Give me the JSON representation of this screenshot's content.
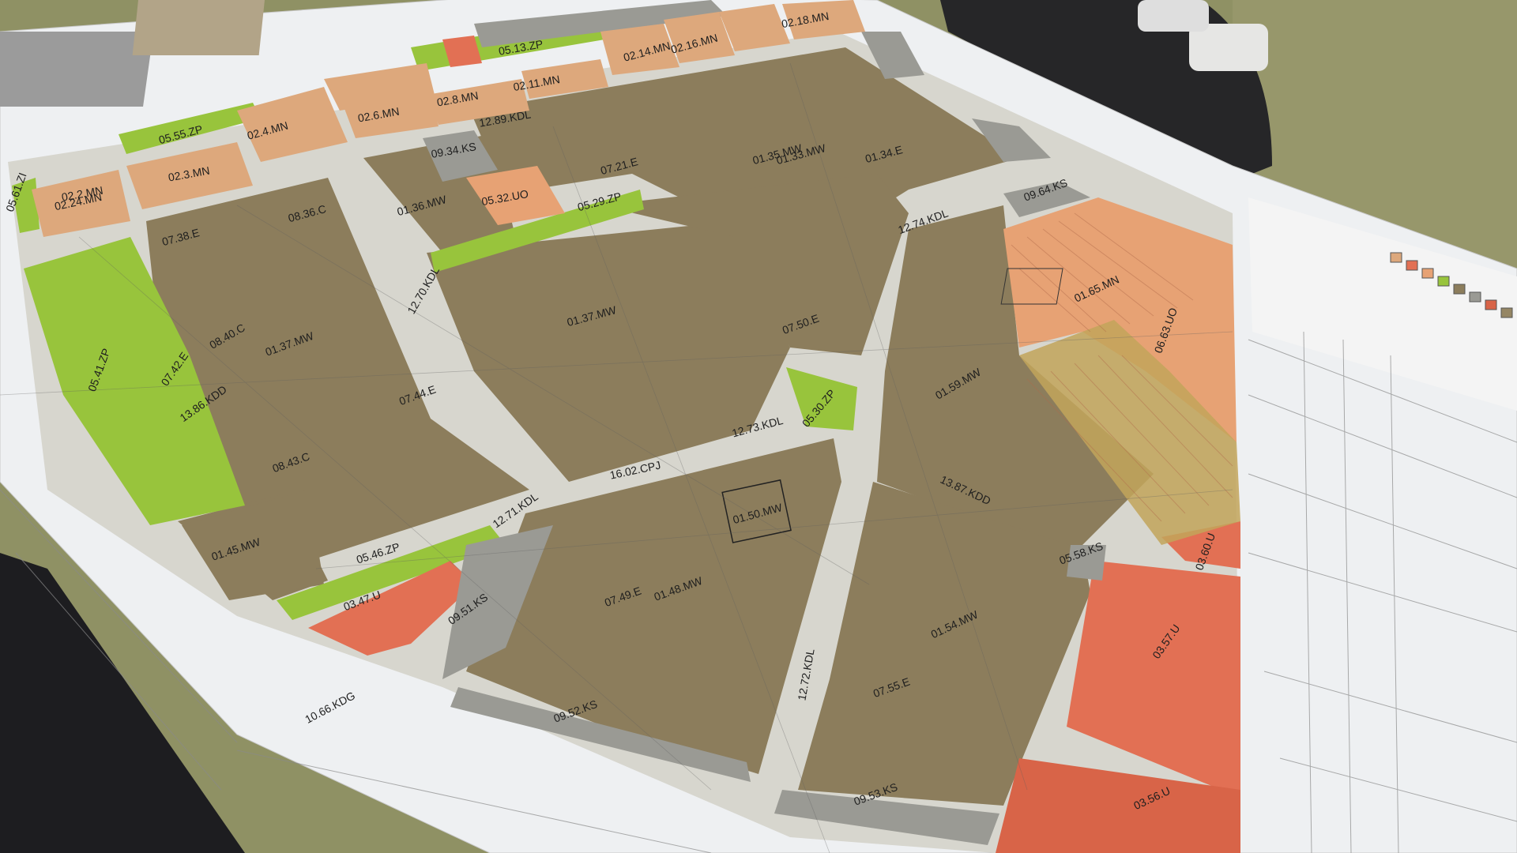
{
  "map": {
    "zone_colors": {
      "mw": "#8c7d5c",
      "mw_light": "#958664",
      "zp": "#98c43c",
      "u": "#e27054",
      "u_dark": "#d86448",
      "road": "#d7d6ce",
      "ks": "#9a9a94",
      "mn": "#dda87c",
      "uo": "#e7a274",
      "sheet": "#eef0f2"
    },
    "labels": [
      {
        "id": "l1",
        "text": "01.45.MW"
      },
      {
        "id": "l2",
        "text": "05.41.ZP"
      },
      {
        "id": "l3",
        "text": "07.42.E"
      },
      {
        "id": "l4",
        "text": "13.86.KDD"
      },
      {
        "id": "l5",
        "text": "08.43.C"
      },
      {
        "id": "l6",
        "text": "01.37.MW"
      },
      {
        "id": "l7",
        "text": "08.40.C"
      },
      {
        "id": "l8",
        "text": "07.44.E"
      },
      {
        "id": "l9",
        "text": "05.46.ZP"
      },
      {
        "id": "l10",
        "text": "03.47.U"
      },
      {
        "id": "l11",
        "text": "09.51.KS"
      },
      {
        "id": "l12",
        "text": "10.66.KDG"
      },
      {
        "id": "l13",
        "text": "12.71.KDL"
      },
      {
        "id": "l14",
        "text": "16.02.CPJ"
      },
      {
        "id": "l15",
        "text": "12.70.KDL"
      },
      {
        "id": "l16",
        "text": "01.50.MW"
      },
      {
        "id": "l17",
        "text": "07.49.E"
      },
      {
        "id": "l18",
        "text": "01.48.MW"
      },
      {
        "id": "l19",
        "text": "09.52.KS"
      },
      {
        "id": "l20",
        "text": "12.72.KDL"
      },
      {
        "id": "l21",
        "text": "07.55.E"
      },
      {
        "id": "l22",
        "text": "01.54.MW"
      },
      {
        "id": "l23",
        "text": "09.53.KS"
      },
      {
        "id": "l24",
        "text": "03.56.U"
      },
      {
        "id": "l25",
        "text": "03.57.U"
      },
      {
        "id": "l26",
        "text": "05.30.ZP"
      },
      {
        "id": "l27",
        "text": "12.73.KDL"
      },
      {
        "id": "l28",
        "text": "13.87.KDD"
      },
      {
        "id": "l29",
        "text": "05.58.KS"
      },
      {
        "id": "l30",
        "text": "03.60.U"
      },
      {
        "id": "l31",
        "text": "01.59.MW"
      },
      {
        "id": "l32",
        "text": "01.37.MW"
      },
      {
        "id": "l33",
        "text": "05.32.UO"
      },
      {
        "id": "l34",
        "text": "05.29.ZP"
      },
      {
        "id": "l35",
        "text": "01.36.MW"
      },
      {
        "id": "l36",
        "text": "01.35.MW"
      },
      {
        "id": "l37",
        "text": "02.24.MN"
      },
      {
        "id": "l38",
        "text": "02.3.MN"
      },
      {
        "id": "l39",
        "text": "02.4.MN"
      },
      {
        "id": "l40",
        "text": "02.6.MN"
      },
      {
        "id": "l41",
        "text": "02.8.MN"
      },
      {
        "id": "l42",
        "text": "02.11.MN"
      },
      {
        "id": "l43",
        "text": "02.14.MN"
      },
      {
        "id": "l44",
        "text": "02.16.MN"
      },
      {
        "id": "l45",
        "text": "02.18.MN"
      },
      {
        "id": "l46",
        "text": "05.55.ZP"
      },
      {
        "id": "l47",
        "text": "05.13.ZP"
      },
      {
        "id": "l48",
        "text": "12.89.KDL"
      },
      {
        "id": "l49",
        "text": "09.34.KS"
      },
      {
        "id": "l50",
        "text": "07.38.E"
      },
      {
        "id": "l51",
        "text": "08.36.C"
      },
      {
        "id": "l52",
        "text": "01.33.MW"
      },
      {
        "id": "l53",
        "text": "01.34.E"
      },
      {
        "id": "l54",
        "text": "07.50.E"
      },
      {
        "id": "l55",
        "text": "12.74.KDL"
      },
      {
        "id": "l56",
        "text": "09.64.KS"
      },
      {
        "id": "l57",
        "text": "06.63.UO"
      },
      {
        "id": "l58",
        "text": "01.65.MN"
      },
      {
        "id": "l59",
        "text": "07.21.E"
      },
      {
        "id": "l60",
        "text": "05.61.ZI"
      },
      {
        "id": "l61",
        "text": "02.2.MN"
      }
    ]
  }
}
